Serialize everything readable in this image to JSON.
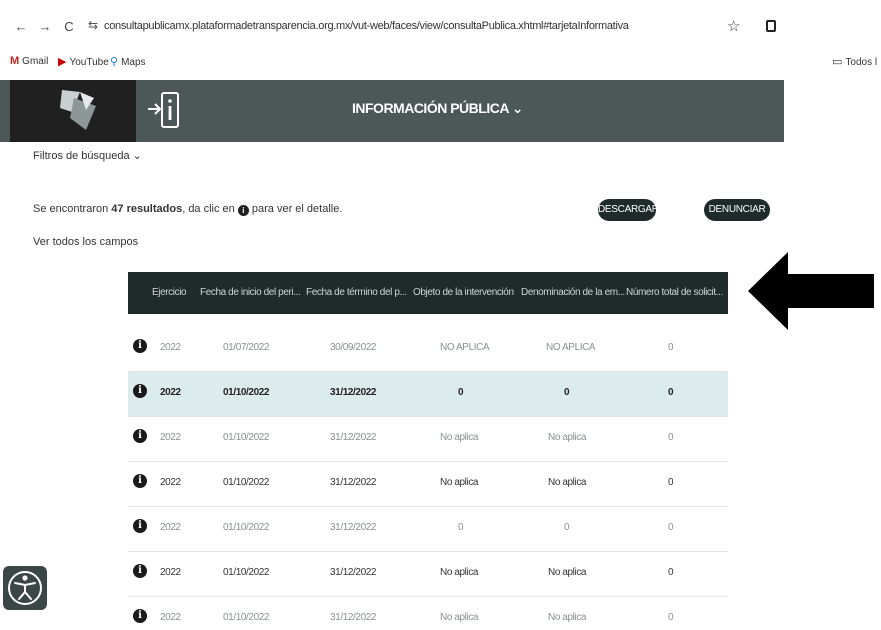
{
  "browser": {
    "back": "←",
    "forward": "→",
    "reload": "C",
    "site_icon": "⇆",
    "url": "consultapublicamx.plataformadetransparencia.org.mx/vut-web/faces/view/consultaPublica.xhtml#tarjetaInformativa",
    "star_icon": "☆",
    "bookmarks": {
      "gmail_glyph": "M",
      "gmail": "Gmail",
      "youtube_glyph": "▶",
      "youtube": "YouTube",
      "maps_glyph": "⚲",
      "maps": "Maps",
      "folder_glyph": "▭",
      "all": "Todos l"
    }
  },
  "header": {
    "title": "INFORMACIÓN PÚBLICA ⌄",
    "colors": {
      "band": "#4c5858",
      "logo_bg": "#202020"
    }
  },
  "filters_label": "Filtros de búsqueda ⌄",
  "results": {
    "prefix": "Se encontraron ",
    "count": "47 resultados",
    "mid": ", da clic en ",
    "icon_glyph": "i",
    "suffix": " para ver el detalle."
  },
  "see_all_fields": "Ver todos los campos",
  "buttons": {
    "download": "DESCARGAR",
    "report": "DENUNCIAR"
  },
  "table": {
    "row_icon": "i",
    "columns": [
      "Ejercicio",
      "Fecha de inicio del peri...",
      "Fecha de término del p...",
      "Objeto de la intervención",
      "Denominación de la em...",
      "Número total de solicit..."
    ],
    "rows": [
      [
        "2022",
        "01/07/2022",
        "30/09/2022",
        "NO APLICA",
        "NO APLICA",
        "0"
      ],
      [
        "2022",
        "01/10/2022",
        "31/12/2022",
        "0",
        "0",
        "0"
      ],
      [
        "2022",
        "01/10/2022",
        "31/12/2022",
        "No aplica",
        "No aplica",
        "0"
      ],
      [
        "2022",
        "01/10/2022",
        "31/12/2022",
        "No aplica",
        "No aplica",
        "0"
      ],
      [
        "2022",
        "01/10/2022",
        "31/12/2022",
        "0",
        "0",
        "0"
      ],
      [
        "2022",
        "01/10/2022",
        "31/12/2022",
        "No aplica",
        "No aplica",
        "0"
      ],
      [
        "2022",
        "01/10/2022",
        "31/12/2022",
        "No aplica",
        "No aplica",
        "0"
      ]
    ],
    "header_color": "#1f2b2b",
    "highlight_color": "#dcecec"
  },
  "icons": [
    "info-icon",
    "arrow-left-icon",
    "accessibility-icon"
  ]
}
